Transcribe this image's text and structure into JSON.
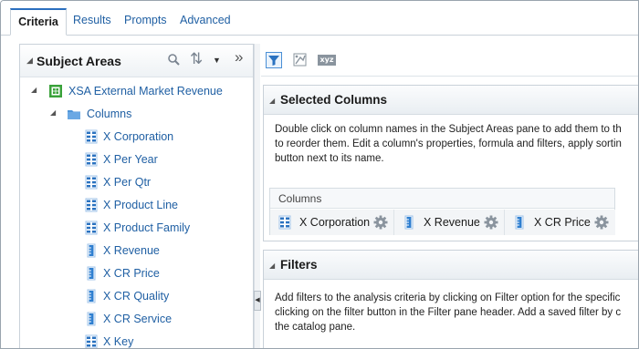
{
  "tabs": {
    "criteria": "Criteria",
    "results": "Results",
    "prompts": "Prompts",
    "advanced": "Advanced"
  },
  "subject_pane": {
    "title": "Subject Areas",
    "subject_area": "XSA External Market Revenue",
    "folder": "Columns",
    "items": [
      {
        "label": "X Corporation",
        "icon": "attribute-icon"
      },
      {
        "label": "X Per Year",
        "icon": "attribute-icon"
      },
      {
        "label": "X Per Qtr",
        "icon": "attribute-icon"
      },
      {
        "label": "X Product Line",
        "icon": "attribute-icon"
      },
      {
        "label": "X Product Family",
        "icon": "attribute-icon"
      },
      {
        "label": "X Revenue",
        "icon": "measure-icon"
      },
      {
        "label": "X CR Price",
        "icon": "measure-icon"
      },
      {
        "label": "X CR Quality",
        "icon": "measure-icon"
      },
      {
        "label": "X CR Service",
        "icon": "measure-icon"
      },
      {
        "label": "X Key",
        "icon": "attribute-icon"
      }
    ]
  },
  "toolbar": {
    "xyz_label": "xyz"
  },
  "selected_columns": {
    "title": "Selected Columns",
    "description_lines": [
      "Double click on column names in the Subject Areas pane to add them to th",
      "to reorder them. Edit a column's properties, formula and filters, apply sortin",
      "button next to its name."
    ],
    "columns_label": "Columns",
    "columns": [
      {
        "label": "X Corporation",
        "icon": "attribute-icon"
      },
      {
        "label": "X Revenue",
        "icon": "measure-icon"
      },
      {
        "label": "X CR Price",
        "icon": "measure-icon"
      }
    ]
  },
  "filters": {
    "title": "Filters",
    "description_lines": [
      "Add filters to the analysis criteria by clicking on Filter option for the specific",
      "clicking on the filter button in the Filter pane header. Add a saved filter by c",
      "the catalog pane."
    ]
  },
  "colors": {
    "link_blue": "#1f5fa3",
    "tab_accent": "#2b6fbf",
    "subject_green": "#3aa23a",
    "folder_blue": "#4f95d9",
    "attribute_blue": "#2a72c0",
    "measure_blue": "#2f7fd0",
    "gear_gray": "#8a949e"
  }
}
